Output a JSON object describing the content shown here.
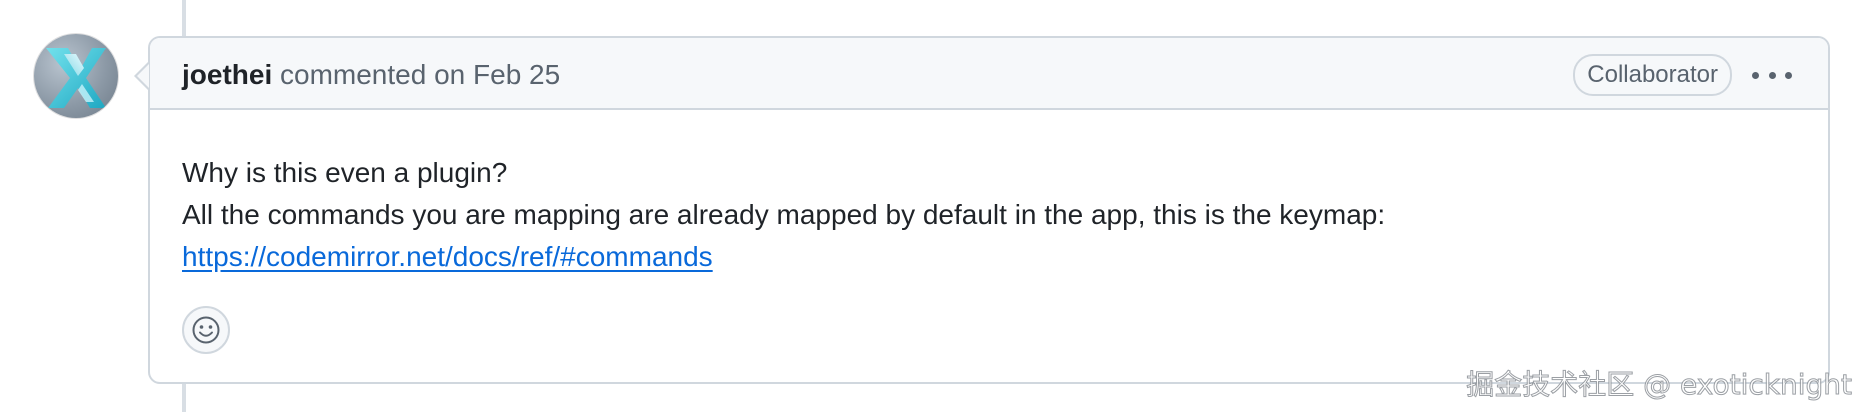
{
  "comment": {
    "author": "joethei",
    "action": "commented on",
    "date": "Feb 25",
    "badge": "Collaborator",
    "body_lines": [
      "Why is this even a plugin?",
      "All the commands you are mapping are already mapped by default in the app, this is the keymap:"
    ],
    "link_text": "https://codemirror.net/docs/ref/#commands"
  },
  "icons": {
    "avatar": "user-avatar",
    "more_options": "kebab-horizontal-icon",
    "reaction": "smiley-icon"
  },
  "watermark": "掘金技术社区 @ exoticknight",
  "colors": {
    "link": "#0969da",
    "border": "#d0d7de",
    "header_bg": "#f6f8fa",
    "muted_text": "#59636e",
    "text": "#1f2328"
  }
}
